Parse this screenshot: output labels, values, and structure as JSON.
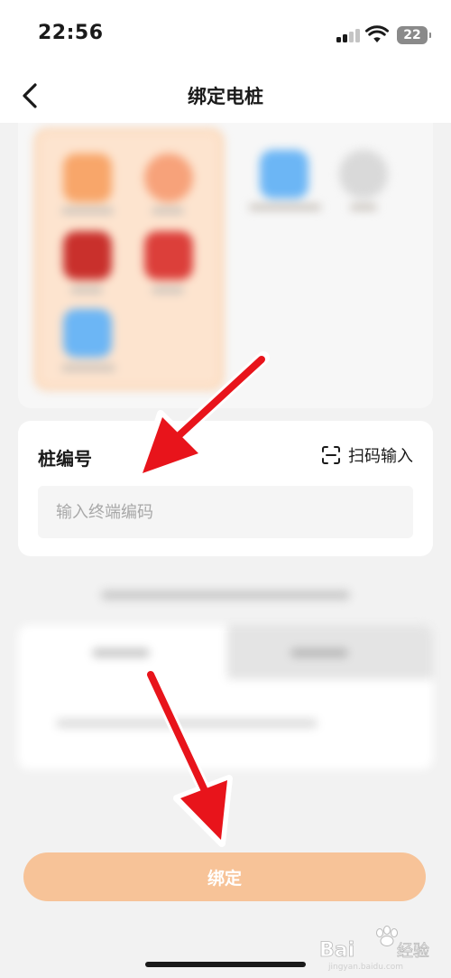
{
  "status_bar": {
    "time": "22:56",
    "battery": "22",
    "icons": [
      "signal-icon",
      "wifi-icon",
      "battery-icon"
    ]
  },
  "nav": {
    "title": "绑定电桩",
    "back_icon": "chevron-left-icon"
  },
  "pile_card": {
    "label": "桩编号",
    "scan_label": "扫码输入",
    "scan_icon": "scan-icon",
    "input_placeholder": "输入终端编码",
    "input_value": ""
  },
  "bind_button": {
    "label": "绑定"
  },
  "watermark": {
    "text": "Bai 经验",
    "subtext": "jingyan.baidu.com"
  },
  "colors": {
    "accent_button": "#f7c398",
    "selected_group_bg": "#fde4cf",
    "annotation_arrow": "#e8141b",
    "page_bg": "#f2f2f2"
  }
}
